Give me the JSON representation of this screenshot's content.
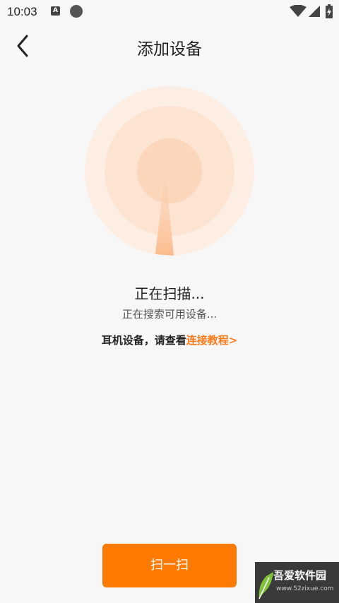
{
  "status_bar": {
    "time": "10:03",
    "notification_letter": "A"
  },
  "header": {
    "title": "添加设备"
  },
  "scan": {
    "status": "正在扫描...",
    "subtitle": "正在搜索可用设备..."
  },
  "hint": {
    "text": "耳机设备，请查看",
    "link": "连接教程>"
  },
  "scan_button_label": "扫一扫",
  "watermark": {
    "text": "吾爱软件园",
    "url": "www.52zixue.com"
  },
  "colors": {
    "accent": "#ff7a00",
    "radar_outer": "#fdeee4",
    "radar_middle": "#fde0cc",
    "radar_inner": "#fcceae"
  }
}
